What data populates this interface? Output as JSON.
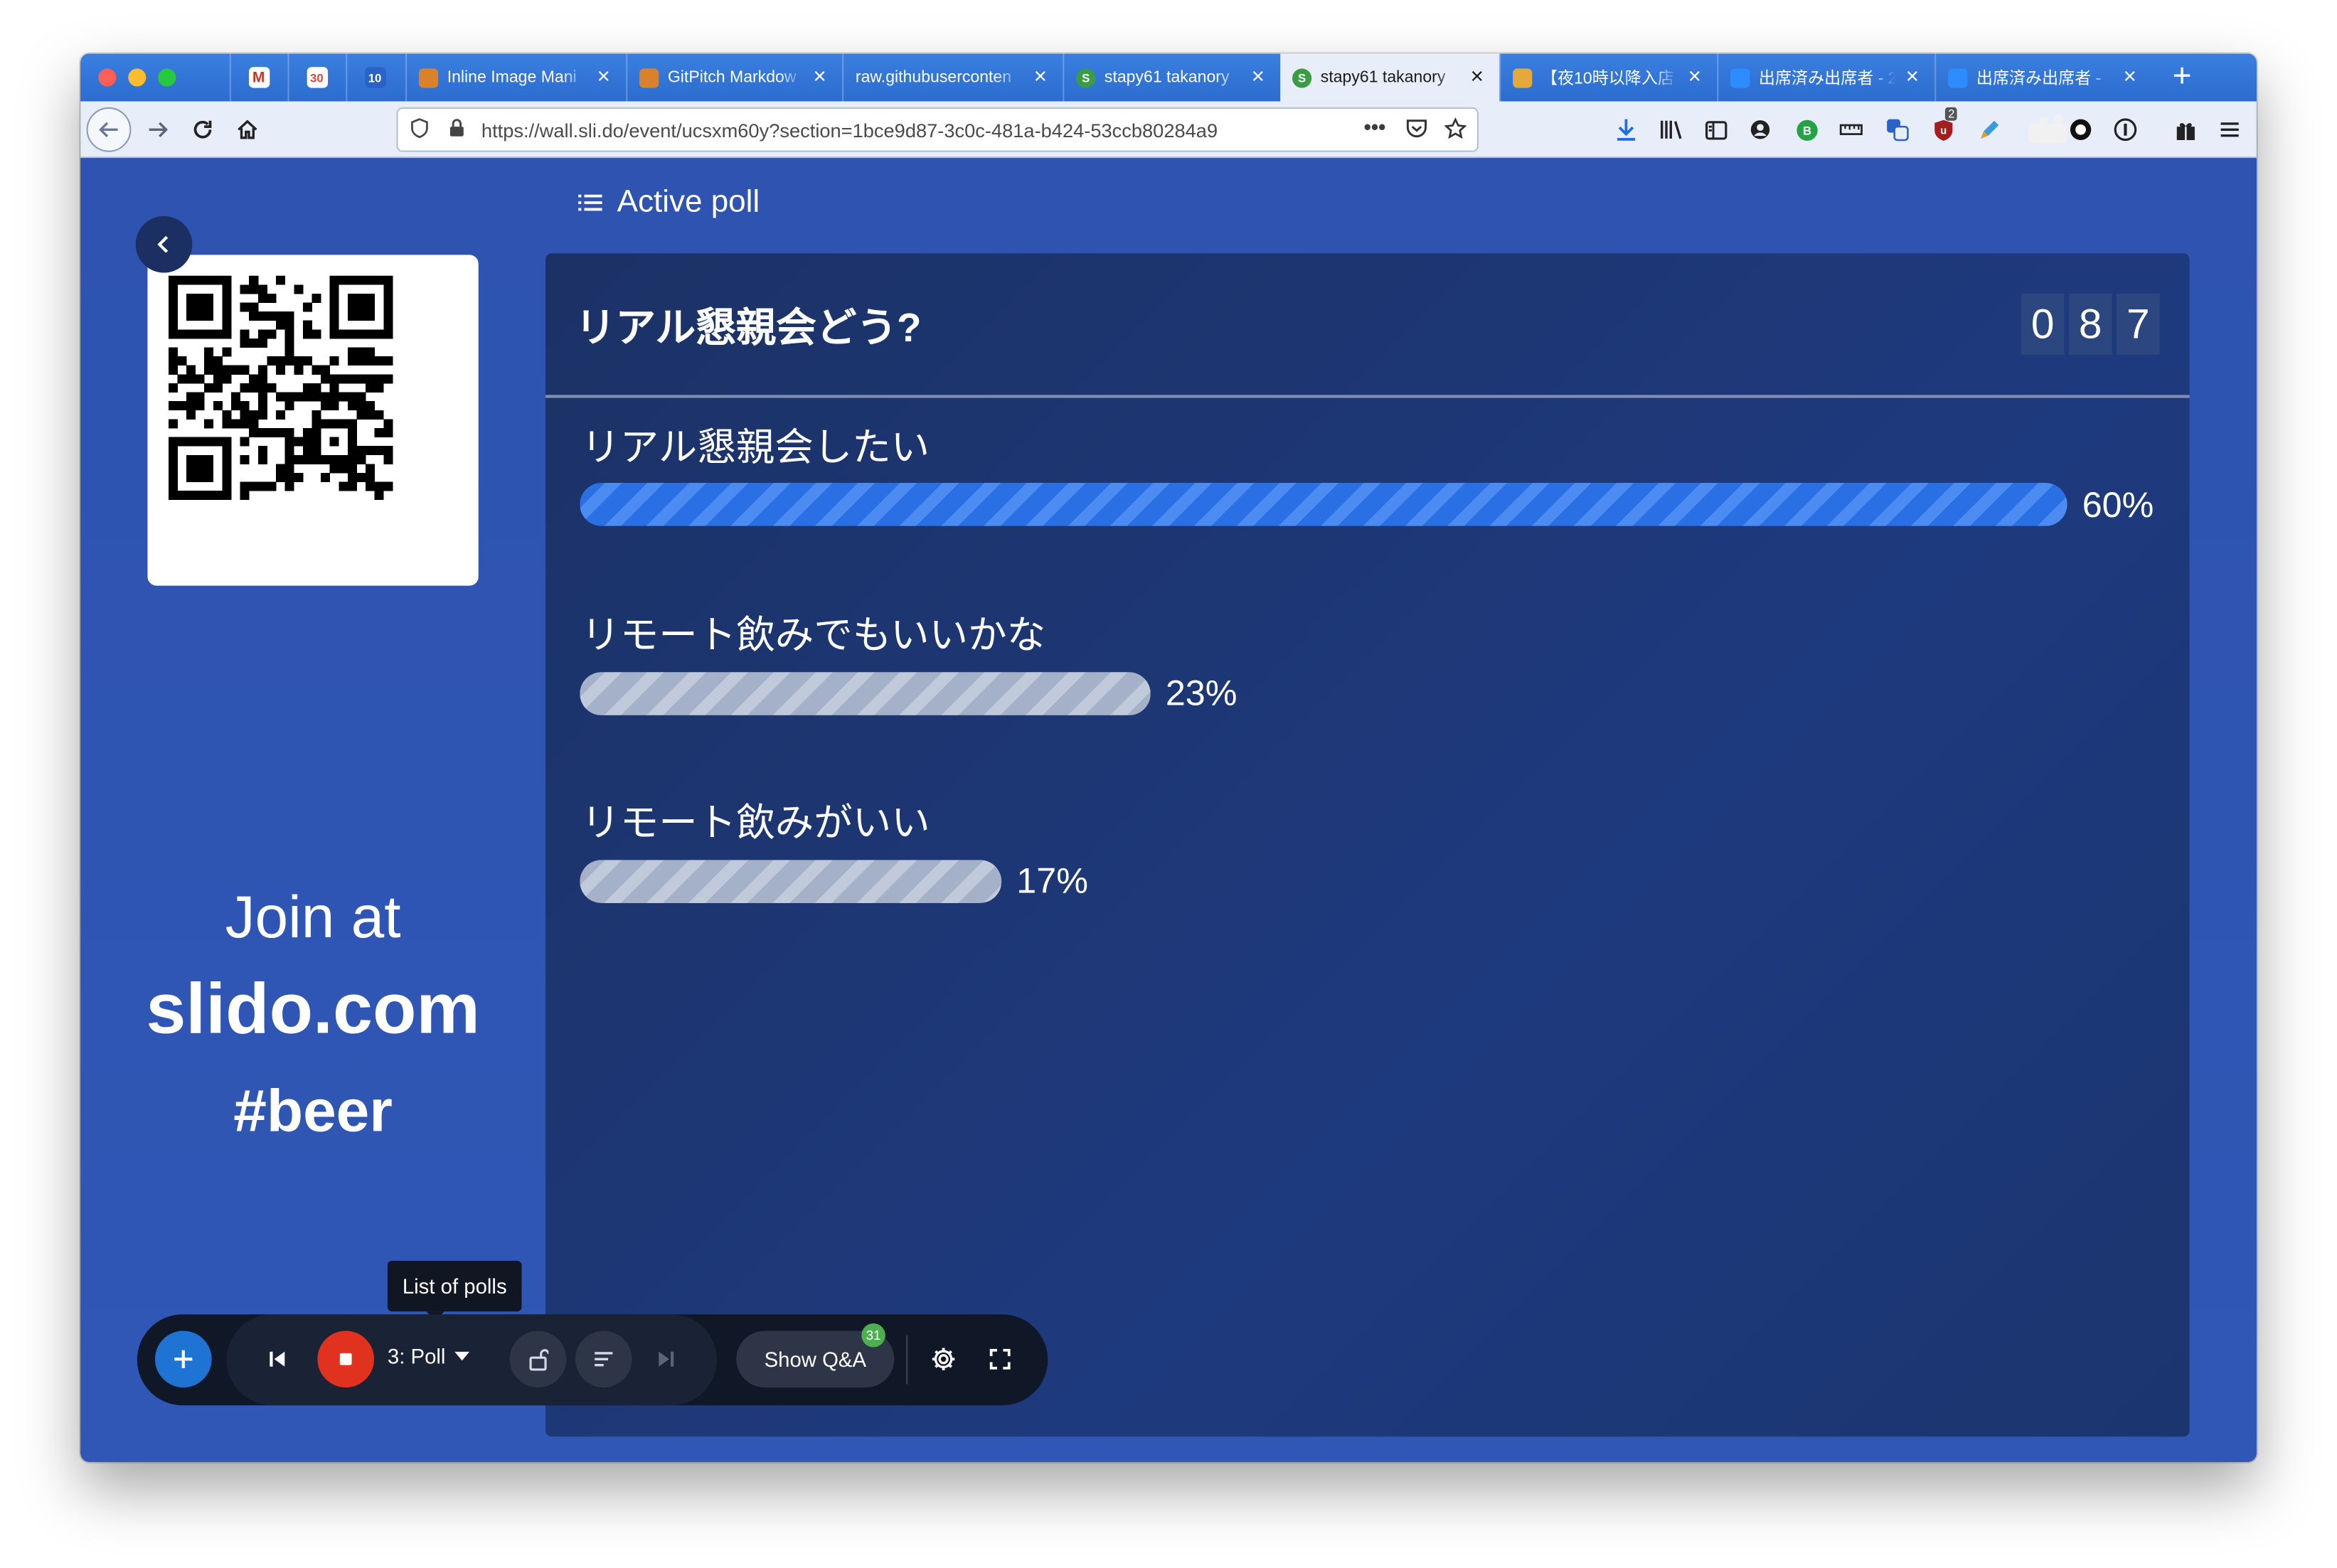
{
  "browser": {
    "pinned_tabs": [
      {
        "icon": "gmail-icon",
        "color": "#c3382c",
        "glyph": "M"
      },
      {
        "icon": "calendar-30-icon",
        "color": "#d14b3e",
        "glyph": "30"
      },
      {
        "icon": "calendar-10-icon",
        "color": "#2a62c8",
        "glyph": "10"
      }
    ],
    "tabs": [
      {
        "title": "Inline Image Mani",
        "fav_color": "#d9822b",
        "active": false
      },
      {
        "title": "GitPitch Markdow",
        "fav_color": "#d9822b",
        "active": false
      },
      {
        "title": "raw.githubuserconten",
        "fav_color": "",
        "active": false
      },
      {
        "title": "stapy61 takanory",
        "fav_color": "#3a9d46",
        "fav_glyph": "S",
        "active": false
      },
      {
        "title": "stapy61 takanory",
        "fav_color": "#3a9d46",
        "fav_glyph": "S",
        "active": true
      },
      {
        "title": "【夜10時以降入店",
        "fav_color": "#e4a93a",
        "active": false
      },
      {
        "title": "出席済み出席者 - 2",
        "fav_color": "#2d8cff",
        "active": false
      },
      {
        "title": "出席済み出席者 -",
        "fav_color": "#2d8cff",
        "active": false
      }
    ],
    "url": "https://wall.sli.do/event/ucsxm60y?section=1bce9d87-3c0c-481a-b424-53ccb80284a9",
    "url_more": "•••",
    "extension_badge": "2"
  },
  "sidebar": {
    "join_line1": "Join at",
    "join_line2": "slido.com",
    "join_line3": "#beer"
  },
  "poll": {
    "section_title": "Active poll",
    "question": "リアル懇親会どう?",
    "vote_digits": [
      "0",
      "8",
      "7"
    ],
    "options": [
      {
        "label": "リアル懇親会したい",
        "percent_text": "60%",
        "percent": 60,
        "winner": true
      },
      {
        "label": "リモート飲みでもいいかな",
        "percent_text": "23%",
        "percent": 23,
        "winner": false
      },
      {
        "label": "リモート飲みがいい",
        "percent_text": "17%",
        "percent": 17,
        "winner": false
      }
    ]
  },
  "controls": {
    "tooltip": "List of polls",
    "poll_selector": "3: Poll",
    "show_qa_label": "Show Q&A",
    "qa_badge": "31"
  },
  "colors": {
    "page_bg": "#2f55b3",
    "panel_bg": "#1c3470",
    "winner_bar": "#2a6fe3",
    "other_bar": "#a5b1c9",
    "stop_button": "#e0321f",
    "add_button": "#1f73d3"
  }
}
